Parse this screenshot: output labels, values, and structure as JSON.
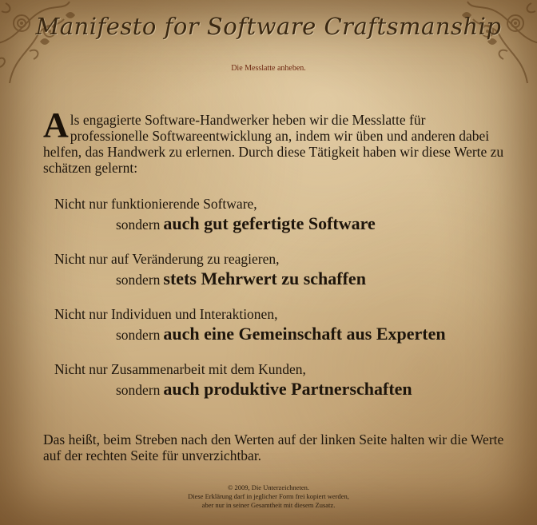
{
  "header": {
    "title": "Manifesto for Software Craftsmanship",
    "subtitle": "Die Messlatte anheben."
  },
  "intro": {
    "dropcap": "A",
    "text": "ls engagierte Software-Handwerker heben wir die Messlatte für professionelle Softwareentwicklung an, indem wir üben und anderen dabei helfen, das Handwerk zu erlernen. Durch diese Tätigkeit haben wir diese Werte zu schätzen gelernt:"
  },
  "values": [
    {
      "lhs": "Nicht nur funktionierende Software,",
      "rhs_prefix": "sondern",
      "rhs_strong": "auch gut gefertigte Software"
    },
    {
      "lhs": "Nicht nur auf Veränderung zu reagieren,",
      "rhs_prefix": "sondern",
      "rhs_strong": "stets Mehrwert zu schaffen"
    },
    {
      "lhs": "Nicht nur Individuen und Interaktionen,",
      "rhs_prefix": "sondern",
      "rhs_strong": "auch eine Gemeinschaft aus Experten"
    },
    {
      "lhs": "Nicht nur Zusammenarbeit mit dem Kunden,",
      "rhs_prefix": "sondern",
      "rhs_strong": "auch produktive Partnerschaften"
    }
  ],
  "outro": "Das heißt, beim Streben nach den Werten auf der linken Seite halten wir die Werte auf der rechten Seite für unverzichtbar.",
  "footer": {
    "copyright": "© 2009, Die Unterzeichneten.",
    "line2": "Diese Erklärung darf in jeglicher Form frei kopiert werden,",
    "line3": "aber nur in seiner Gesamtheit mit diesem Zusatz."
  }
}
